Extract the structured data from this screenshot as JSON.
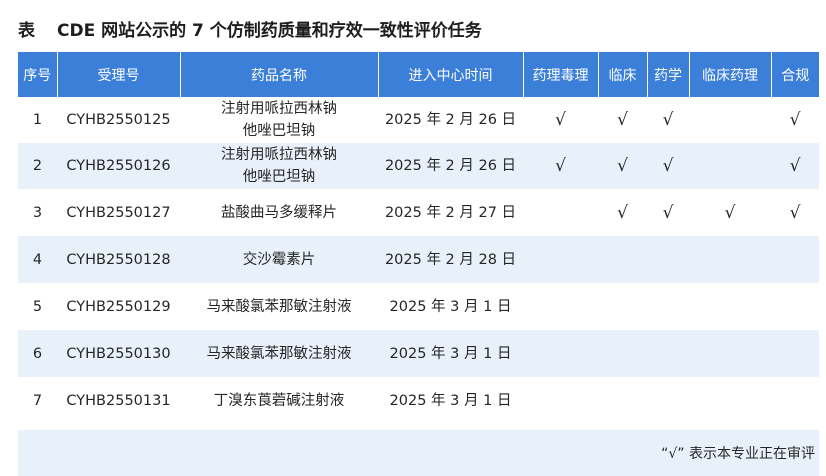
{
  "title": {
    "tag": "表",
    "text": "CDE 网站公示的 7 个仿制药质量和疗效一致性评价任务"
  },
  "table": {
    "headers": [
      "序号",
      "受理号",
      "药品名称",
      "进入中心时间",
      "药理毒理",
      "临床",
      "药学",
      "临床药理",
      "合规"
    ],
    "rows": [
      {
        "no": "1",
        "id": "CYHB2550125",
        "name_lines": [
          "注射用哌拉西林钠",
          "他唑巴坦钠"
        ],
        "date": "2025 年 2 月 26 日",
        "checks": [
          "√",
          "√",
          "√",
          "",
          "√"
        ]
      },
      {
        "no": "2",
        "id": "CYHB2550126",
        "name_lines": [
          "注射用哌拉西林钠",
          "他唑巴坦钠"
        ],
        "date": "2025 年 2 月 26 日",
        "checks": [
          "√",
          "√",
          "√",
          "",
          "√"
        ]
      },
      {
        "no": "3",
        "id": "CYHB2550127",
        "name_lines": [
          "盐酸曲马多缓释片"
        ],
        "date": "2025 年 2 月 27 日",
        "checks": [
          "",
          "√",
          "√",
          "√",
          "√"
        ]
      },
      {
        "no": "4",
        "id": "CYHB2550128",
        "name_lines": [
          "交沙霉素片"
        ],
        "date": "2025 年 2 月 28 日",
        "checks": [
          "",
          "",
          "",
          "",
          ""
        ]
      },
      {
        "no": "5",
        "id": "CYHB2550129",
        "name_lines": [
          "马来酸氯苯那敏注射液"
        ],
        "date": "2025 年 3 月 1 日",
        "checks": [
          "",
          "",
          "",
          "",
          ""
        ]
      },
      {
        "no": "6",
        "id": "CYHB2550130",
        "name_lines": [
          "马来酸氯苯那敏注射液"
        ],
        "date": "2025 年 3 月 1 日",
        "checks": [
          "",
          "",
          "",
          "",
          ""
        ]
      },
      {
        "no": "7",
        "id": "CYHB2550131",
        "name_lines": [
          "丁溴东莨菪碱注射液"
        ],
        "date": "2025 年 3 月 1 日",
        "checks": [
          "",
          "",
          "",
          "",
          ""
        ]
      }
    ]
  },
  "footnote": "“√” 表示本专业正在审评"
}
